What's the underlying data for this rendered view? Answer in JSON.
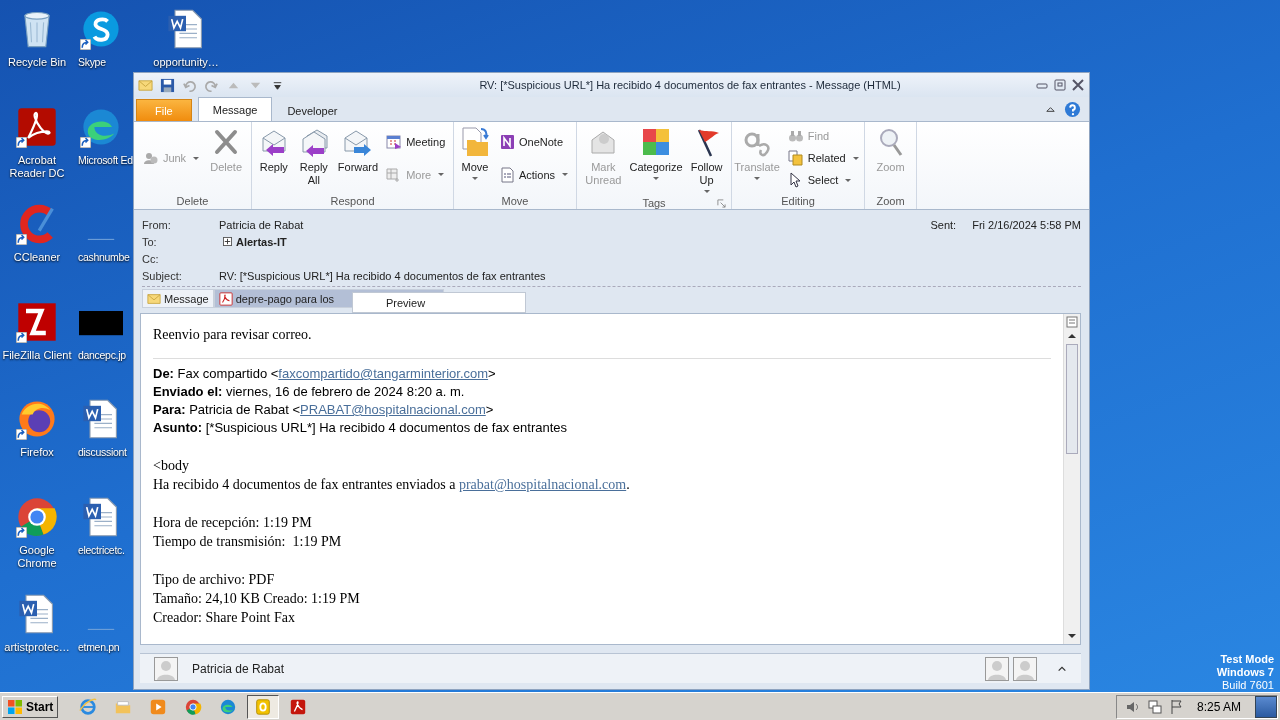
{
  "desktop_columns": [
    [
      {
        "label": "Recycle Bin",
        "kind": "recycle-bin",
        "shortcut": false
      },
      {
        "label": "Acrobat Reader DC",
        "kind": "acrobat",
        "shortcut": true
      },
      {
        "label": "CCleaner",
        "kind": "ccleaner",
        "shortcut": true
      },
      {
        "label": "FileZilla Client",
        "kind": "filezilla",
        "shortcut": true
      },
      {
        "label": "Firefox",
        "kind": "firefox",
        "shortcut": true
      },
      {
        "label": "Google Chrome",
        "kind": "chrome",
        "shortcut": true
      },
      {
        "label": "artistprotec…",
        "kind": "word",
        "shortcut": false
      }
    ],
    [
      {
        "label": "Skype",
        "kind": "skype",
        "shortcut": true
      },
      {
        "label": "Microsoft Ed",
        "kind": "edge",
        "shortcut": true
      },
      {
        "label": "cashnumbe",
        "kind": "blank",
        "shortcut": false
      },
      {
        "label": "dancepc.jp",
        "kind": "image",
        "shortcut": false
      },
      {
        "label": "discussiont",
        "kind": "word",
        "shortcut": false
      },
      {
        "label": "electricetc.",
        "kind": "word",
        "shortcut": false
      },
      {
        "label": "etmen.pn",
        "kind": "blank",
        "shortcut": false
      }
    ],
    [
      {
        "label": "opportunity…",
        "kind": "word",
        "shortcut": false
      }
    ]
  ],
  "window": {
    "title": "RV: [*Suspicious URL*] Ha recibido 4 documentos de fax entrantes -  Message (HTML)",
    "ribbon_tabs": [
      {
        "label": "File",
        "kind": "file",
        "selected": false
      },
      {
        "label": "Message",
        "kind": "tab",
        "selected": true
      },
      {
        "label": "Developer",
        "kind": "tab",
        "selected": false
      }
    ],
    "ribbon_groups": [
      {
        "label": "Delete",
        "launcher": false,
        "items": [
          {
            "kind": "stack",
            "buttons": [
              {
                "label": "Junk",
                "disabled": true,
                "dropdown": true
              }
            ]
          },
          {
            "kind": "large",
            "label": "Delete",
            "disabled": true,
            "dropdown": false
          }
        ]
      },
      {
        "label": "Respond",
        "launcher": false,
        "items": [
          {
            "kind": "large",
            "label": "Reply",
            "disabled": false,
            "dropdown": false
          },
          {
            "kind": "large",
            "label": "Reply All",
            "disabled": false,
            "dropdown": false
          },
          {
            "kind": "large",
            "label": "Forward",
            "disabled": false,
            "dropdown": false
          },
          {
            "kind": "stack",
            "buttons": [
              {
                "label": "Meeting",
                "disabled": false,
                "dropdown": false
              },
              {
                "label": "More",
                "disabled": true,
                "dropdown": true
              }
            ]
          }
        ]
      },
      {
        "label": "Move",
        "launcher": false,
        "items": [
          {
            "kind": "large",
            "label": "Move",
            "disabled": false,
            "dropdown": true
          },
          {
            "kind": "stack",
            "buttons": [
              {
                "label": "OneNote",
                "disabled": false,
                "dropdown": false
              },
              {
                "label": "Actions",
                "disabled": false,
                "dropdown": true
              }
            ]
          }
        ]
      },
      {
        "label": "Tags",
        "launcher": true,
        "items": [
          {
            "kind": "large",
            "label": "Mark Unread",
            "disabled": true,
            "dropdown": false
          },
          {
            "kind": "large",
            "label": "Categorize",
            "disabled": false,
            "dropdown": true
          },
          {
            "kind": "large",
            "label": "Follow Up",
            "disabled": false,
            "dropdown": true
          }
        ]
      },
      {
        "label": "Editing",
        "launcher": false,
        "items": [
          {
            "kind": "large",
            "label": "Translate",
            "disabled": true,
            "dropdown": true
          },
          {
            "kind": "stack",
            "buttons": [
              {
                "label": "Find",
                "disabled": true,
                "dropdown": false
              },
              {
                "label": "Related",
                "disabled": false,
                "dropdown": true
              },
              {
                "label": "Select",
                "disabled": false,
                "dropdown": true
              }
            ]
          }
        ]
      },
      {
        "label": "Zoom",
        "launcher": false,
        "items": [
          {
            "kind": "large",
            "label": "Zoom",
            "disabled": true,
            "dropdown": false
          }
        ]
      }
    ],
    "header": {
      "from_label": "From:",
      "from": "Patricia de Rabat",
      "to_label": "To:",
      "to": "Alertas-IT",
      "cc_label": "Cc:",
      "subject_label": "Subject:",
      "subject": "RV: [*Suspicious URL*] Ha recibido 4 documentos de fax entrantes",
      "sent_label": "Sent:",
      "sent": "Fri 2/16/2024 5:58 PM"
    },
    "attachment_tabs": [
      {
        "label": "Message",
        "kind": "message",
        "selected": false
      },
      {
        "label": "depre-pago para los",
        "kind": "pdf",
        "selected": true
      }
    ],
    "popup_menu": [
      "Preview"
    ],
    "body": {
      "intro": "Reenvio para revisar correo.",
      "forward_header": [
        {
          "label": "De:",
          "text": "Fax compartido <",
          "link": "faxcompartido@tangarminterior.com",
          "after": ">"
        },
        {
          "label": "Enviado el:",
          "text": "viernes, 16 de febrero de 2024 8:20 a. m."
        },
        {
          "label": "Para:",
          "text": "Patricia de Rabat <",
          "link": "PRABAT@hospitalnacional.com",
          "after": ">"
        },
        {
          "label": "Asunto:",
          "text": "[*Suspicious URL*] Ha recibido 4 documentos de fax entrantes"
        }
      ],
      "paragraphs": [
        [
          {
            "text": "<body"
          },
          {
            "text": "Ha recibido 4 documentos de fax entrantes enviados a ",
            "link": "prabat@hospitalnacional.com",
            "after": "."
          }
        ],
        [
          {
            "text": "Hora de recepción: 1:19 PM"
          },
          {
            "text": "Tiempo de transmisión:  1:19 PM"
          }
        ],
        [
          {
            "text": "Tipo de archivo: PDF"
          },
          {
            "text": "Tamaño: 24,10 KB Creado: 1:19 PM"
          },
          {
            "text": "Creador: Share Point Fax"
          }
        ]
      ]
    },
    "people_pane": {
      "name": "Patricia de Rabat"
    }
  },
  "taskbar": {
    "start": "Start",
    "apps": [
      {
        "kind": "ie",
        "selected": false
      },
      {
        "kind": "explorer",
        "selected": false
      },
      {
        "kind": "media",
        "selected": false
      },
      {
        "kind": "chrome",
        "selected": false
      },
      {
        "kind": "edge",
        "selected": false
      },
      {
        "kind": "outlook",
        "selected": true
      },
      {
        "kind": "acrobat",
        "selected": false
      }
    ],
    "clock": "8:25 AM"
  },
  "watermark_text": [
    "Test Mode",
    "Windows 7",
    "Build 7601"
  ]
}
